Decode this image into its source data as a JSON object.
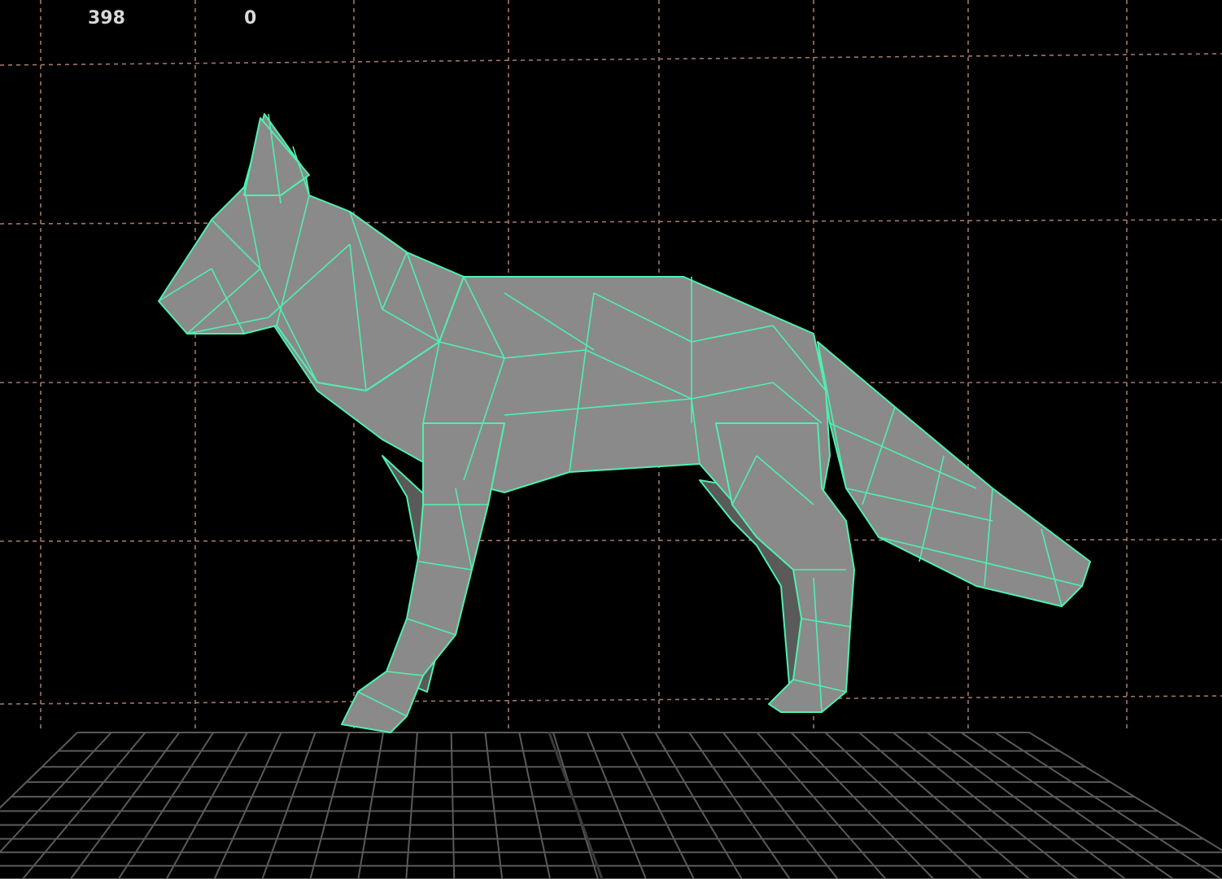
{
  "hud": {
    "left_value": "398",
    "right_value": "0"
  },
  "colors": {
    "background": "#000000",
    "wireframe": "#4ff0b0",
    "surface": "#8a8a8a",
    "surface_shadow": "#5a5a5a",
    "grid_floor": "#5a5a5a",
    "grid_back": "#c08a7a",
    "hud_text": "#d8d8d8"
  },
  "scene": {
    "object": "low-poly-fox-mesh",
    "view": "perspective"
  }
}
